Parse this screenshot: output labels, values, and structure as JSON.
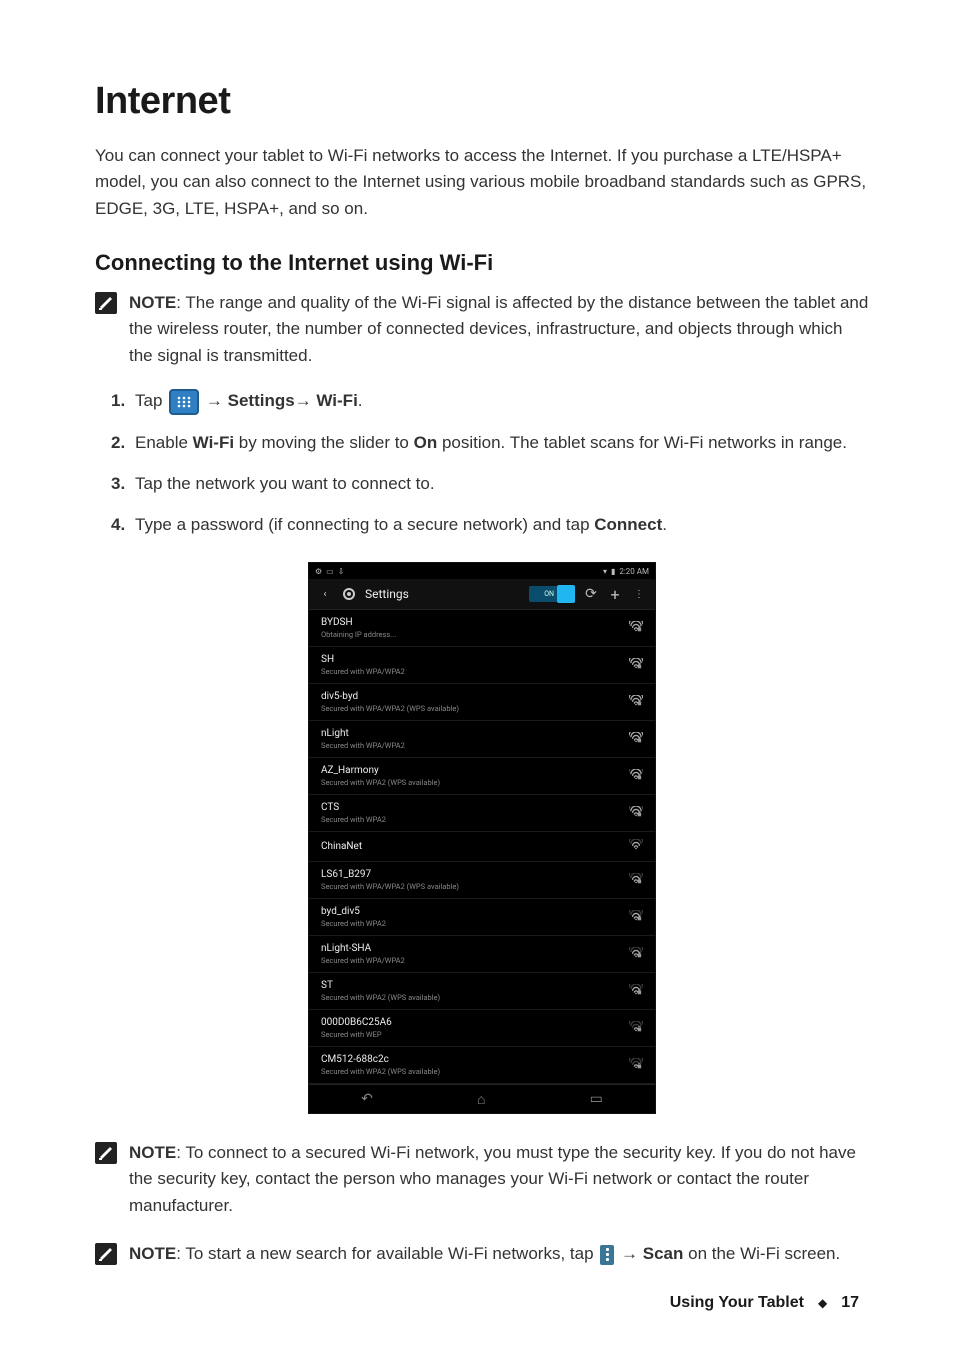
{
  "title": "Internet",
  "intro": "You can connect your tablet to Wi-Fi networks to access the Internet. If you purchase a LTE/HSPA+ model, you can also connect to the Internet using various mobile broadband standards such as GPRS, EDGE, 3G, LTE, HSPA+, and so on.",
  "section_heading": "Connecting to the Internet using Wi-Fi",
  "note1": {
    "label": "NOTE",
    "text": ": The range and quality of the Wi-Fi signal is affected by the distance between the tablet and the wireless router, the number of connected devices, infrastructure, and objects through which the signal is transmitted."
  },
  "steps": {
    "s1": {
      "pre": "Tap ",
      "arrow1": " → ",
      "settings": "Settings",
      "arrow2": "→ ",
      "wifi": "Wi-Fi",
      "post": "."
    },
    "s2": {
      "pre": "Enable ",
      "wifi": "Wi-Fi",
      "mid": " by moving the slider to ",
      "on": "On",
      "post": " position. The tablet scans for Wi-Fi networks in range."
    },
    "s3": "Tap the network you want to connect to.",
    "s4": {
      "pre": "Type a password (if connecting to a secure network) and tap ",
      "connect": "Connect",
      "post": "."
    }
  },
  "screenshot": {
    "status_time": "2:20 AM",
    "header_title": "Settings",
    "toggle_label": "ON",
    "networks": [
      {
        "name": "BYDSH",
        "sub": "Obtaining IP address...",
        "lock": true,
        "strength": 4
      },
      {
        "name": "SH",
        "sub": "Secured with WPA/WPA2",
        "lock": true,
        "strength": 4
      },
      {
        "name": "div5-byd",
        "sub": "Secured with WPA/WPA2 (WPS available)",
        "lock": true,
        "strength": 4
      },
      {
        "name": "nLight",
        "sub": "Secured with WPA/WPA2",
        "lock": true,
        "strength": 4
      },
      {
        "name": "AZ_Harmony",
        "sub": "Secured with WPA2 (WPS available)",
        "lock": true,
        "strength": 3
      },
      {
        "name": "CTS",
        "sub": "Secured with WPA2",
        "lock": true,
        "strength": 3
      },
      {
        "name": "ChinaNet",
        "sub": "",
        "lock": false,
        "strength": 2
      },
      {
        "name": "LS61_B297",
        "sub": "Secured with WPA/WPA2 (WPS available)",
        "lock": true,
        "strength": 2
      },
      {
        "name": "byd_div5",
        "sub": "Secured with WPA2",
        "lock": true,
        "strength": 2
      },
      {
        "name": "nLight-SHA",
        "sub": "Secured with WPA/WPA2",
        "lock": true,
        "strength": 2
      },
      {
        "name": "ST",
        "sub": "Secured with WPA2 (WPS available)",
        "lock": true,
        "strength": 2
      },
      {
        "name": "000D0B6C25A6",
        "sub": "Secured with WEP",
        "lock": true,
        "strength": 1
      },
      {
        "name": "CM512-688c2c",
        "sub": "Secured with WPA2 (WPS available)",
        "lock": true,
        "strength": 1
      }
    ]
  },
  "note2": {
    "label": "NOTE",
    "text": ": To connect to a secured Wi-Fi network, you must type the security key. If you do not have the security key, contact the person who manages your Wi-Fi network or contact the router manufacturer."
  },
  "note3": {
    "label": "NOTE",
    "pre": ": To start a new search for available Wi-Fi networks, tap ",
    "arrow": " → ",
    "scan": "Scan",
    "post": " on the Wi-Fi screen."
  },
  "footer": {
    "section": "Using Your Tablet",
    "page": "17"
  }
}
